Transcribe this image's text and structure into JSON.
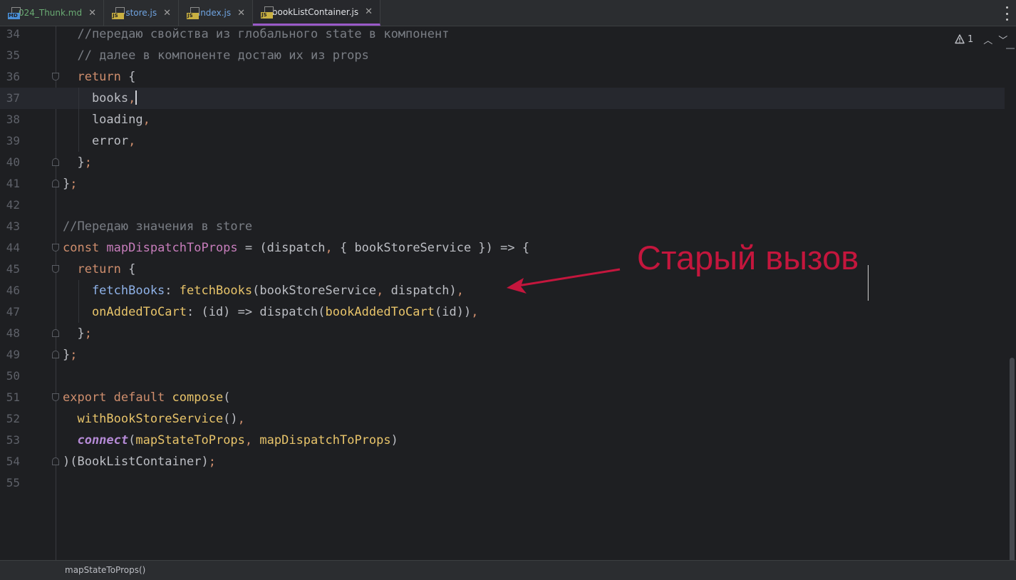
{
  "tabs": [
    {
      "label": "024_Thunk.md",
      "type": "MD",
      "color": "#4a8fd6",
      "label_color": "#6aab73"
    },
    {
      "label": "store.js",
      "type": "JS",
      "color": "#c9b042",
      "label_color": "#6fa3e0"
    },
    {
      "label": "index.js",
      "type": "JS",
      "color": "#c9b042",
      "label_color": "#6fa3e0"
    },
    {
      "label": "bookListContainer.js",
      "type": "JS",
      "color": "#c9b042",
      "label_color": "#dfe1e5",
      "active": true
    }
  ],
  "close_glyph": "✕",
  "inspection": {
    "warnings": "1"
  },
  "lines": [
    {
      "n": "34",
      "segs": [
        [
          "c-comment",
          "  //передаю свойства из глобального state в компонент"
        ]
      ]
    },
    {
      "n": "35",
      "segs": [
        [
          "c-comment",
          "  // далее в компоненте достаю их из props"
        ]
      ]
    },
    {
      "n": "36",
      "segs": [
        [
          "c-kw",
          "  return "
        ],
        [
          "c-punc",
          "{"
        ]
      ]
    },
    {
      "n": "37",
      "segs": [
        [
          "c-punc",
          "    books"
        ],
        [
          "c-comma",
          ","
        ]
      ],
      "current": true
    },
    {
      "n": "38",
      "segs": [
        [
          "c-punc",
          "    loading"
        ],
        [
          "c-comma",
          ","
        ]
      ]
    },
    {
      "n": "39",
      "segs": [
        [
          "c-punc",
          "    error"
        ],
        [
          "c-comma",
          ","
        ]
      ]
    },
    {
      "n": "40",
      "segs": [
        [
          "c-punc",
          "  }"
        ],
        [
          "c-comma",
          ";"
        ]
      ]
    },
    {
      "n": "41",
      "segs": [
        [
          "c-punc",
          "}"
        ],
        [
          "c-comma",
          ";"
        ]
      ]
    },
    {
      "n": "42",
      "segs": []
    },
    {
      "n": "43",
      "segs": [
        [
          "c-comment",
          "//Передаю значения в store"
        ]
      ]
    },
    {
      "n": "44",
      "segs": [
        [
          "c-kw",
          "const "
        ],
        [
          "c-var",
          "mapDispatchToProps"
        ],
        [
          "c-punc",
          " = (dispatch"
        ],
        [
          "c-comma",
          ", "
        ],
        [
          "c-punc",
          "{ bookStoreService }) => {"
        ]
      ]
    },
    {
      "n": "45",
      "segs": [
        [
          "c-kw",
          "  return "
        ],
        [
          "c-punc",
          "{"
        ]
      ]
    },
    {
      "n": "46",
      "segs": [
        [
          "c-prop",
          "    fetchBooks"
        ],
        [
          "c-punc",
          ": "
        ],
        [
          "c-fn",
          "fetchBooks"
        ],
        [
          "c-punc",
          "(bookStoreService"
        ],
        [
          "c-comma",
          ", "
        ],
        [
          "c-punc",
          "dispatch)"
        ],
        [
          "c-comma",
          ","
        ]
      ]
    },
    {
      "n": "47",
      "segs": [
        [
          "c-fn",
          "    onAddedToCart"
        ],
        [
          "c-punc",
          ": (id) => dispatch("
        ],
        [
          "c-fn",
          "bookAddedToCart"
        ],
        [
          "c-punc",
          "(id))"
        ],
        [
          "c-comma",
          ","
        ]
      ]
    },
    {
      "n": "48",
      "segs": [
        [
          "c-punc",
          "  }"
        ],
        [
          "c-comma",
          ";"
        ]
      ]
    },
    {
      "n": "49",
      "segs": [
        [
          "c-punc",
          "}"
        ],
        [
          "c-comma",
          ";"
        ]
      ]
    },
    {
      "n": "50",
      "segs": []
    },
    {
      "n": "51",
      "segs": [
        [
          "c-kw",
          "export default "
        ],
        [
          "c-fn",
          "compose"
        ],
        [
          "c-punc",
          "("
        ]
      ]
    },
    {
      "n": "52",
      "segs": [
        [
          "c-fn",
          "  withBookStoreService"
        ],
        [
          "c-punc",
          "()"
        ],
        [
          "c-comma",
          ","
        ]
      ]
    },
    {
      "n": "53",
      "segs": [
        [
          "c-italic",
          "  connect"
        ],
        [
          "c-punc",
          "("
        ],
        [
          "c-fn",
          "mapStateToProps"
        ],
        [
          "c-comma",
          ", "
        ],
        [
          "c-fn",
          "mapDispatchToProps"
        ],
        [
          "c-punc",
          ")"
        ]
      ]
    },
    {
      "n": "54",
      "segs": [
        [
          "c-punc",
          ")(BookListContainer)"
        ],
        [
          "c-comma",
          ";"
        ]
      ]
    },
    {
      "n": "55",
      "segs": []
    }
  ],
  "annotation": {
    "text": "Старый вызов",
    "color": "#c4163d"
  },
  "breadcrumb": "mapStateToProps()"
}
